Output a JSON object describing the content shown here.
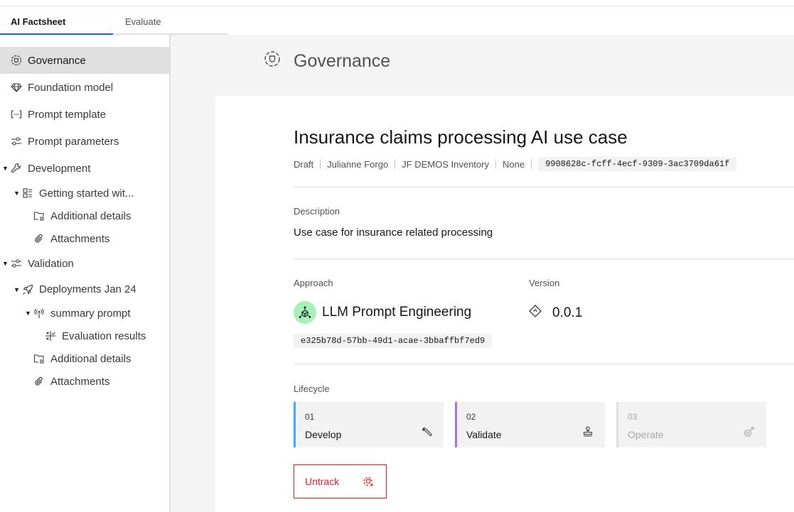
{
  "tabs": [
    {
      "label": "AI Factsheet",
      "active": true
    },
    {
      "label": "Evaluate",
      "active": false
    }
  ],
  "sidebar": {
    "items": [
      {
        "label": "Governance",
        "icon": "governance-icon",
        "active": true
      },
      {
        "label": "Foundation model",
        "icon": "diamond-gem-icon"
      },
      {
        "label": "Prompt template",
        "icon": "brackets-ellipsis-icon"
      },
      {
        "label": "Prompt parameters",
        "icon": "sliders-icon"
      },
      {
        "label": "Development",
        "icon": "wrench-icon",
        "expanded": true
      },
      {
        "label": "Getting started wit...",
        "icon": "grid-icon",
        "expanded": true
      },
      {
        "label": "Additional details",
        "icon": "folder-details-icon"
      },
      {
        "label": "Attachments",
        "icon": "paperclip-icon"
      },
      {
        "label": "Validation",
        "icon": "sliders-icon",
        "expanded": true
      },
      {
        "label": "Deployments Jan 24",
        "icon": "rocket-icon",
        "expanded": true
      },
      {
        "label": "summary prompt",
        "icon": "broadcast-icon",
        "expanded": true
      },
      {
        "label": "Evaluation results",
        "icon": "evaluation-icon"
      },
      {
        "label": "Additional details",
        "icon": "folder-details-icon"
      },
      {
        "label": "Attachments",
        "icon": "paperclip-icon"
      }
    ]
  },
  "page": {
    "title": "Governance"
  },
  "use_case": {
    "title": "Insurance claims processing AI use case",
    "status": "Draft",
    "owner": "Julianne Forgo",
    "inventory": "JF DEMOS Inventory",
    "risk": "None",
    "id": "9908628c-fcff-4ecf-9309-3ac3709da61f",
    "description_label": "Description",
    "description": "Use case for insurance related processing",
    "approach_label": "Approach",
    "approach": "LLM Prompt Engineering",
    "approach_id": "e325b78d-57bb-49d1-acae-3bbaffbf7ed9",
    "version_label": "Version",
    "version": "0.0.1",
    "lifecycle_label": "Lifecycle",
    "lifecycle": [
      {
        "num": "01",
        "name": "Develop",
        "color": "#33b1ff",
        "icon": "wrench-icon",
        "disabled": false
      },
      {
        "num": "02",
        "name": "Validate",
        "color": "#a56eff",
        "icon": "stamp-icon",
        "disabled": false
      },
      {
        "num": "03",
        "name": "Operate",
        "color": "#e0e0e0",
        "icon": "operate-icon",
        "disabled": true
      }
    ],
    "untrack_label": "Untrack"
  },
  "colors": {
    "accent": "#0f62fe",
    "danger": "#da1e28",
    "approach_badge": "#a7f0ba"
  }
}
